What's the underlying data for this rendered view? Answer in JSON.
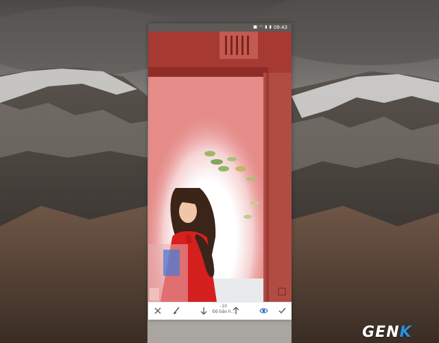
{
  "status_bar": {
    "time": "09:43"
  },
  "editor": {
    "toolbar": {
      "value": "-10",
      "label": "Độ bão h..."
    }
  },
  "watermark": {
    "text_main": "GEN",
    "text_accent": "K"
  },
  "colors": {
    "accent": "#2e67c7",
    "mask_overlay": "#e06a6a",
    "toolbar_icons": "#555555",
    "watermark_k": "#2a8ee0"
  },
  "icons": {
    "cancel": "close-icon",
    "brush": "brush-icon",
    "decrease": "arrow-down-icon",
    "increase": "arrow-up-icon",
    "toggle": "eye-icon",
    "confirm": "check-icon"
  }
}
